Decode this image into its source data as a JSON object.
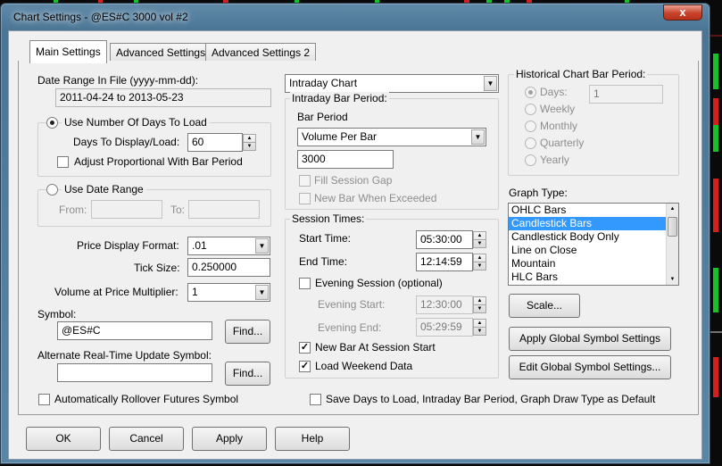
{
  "window": {
    "title": "Chart Settings - @ES#C  3000 vol  #2",
    "close_glyph": "x"
  },
  "tabs": [
    {
      "label": "Main Settings",
      "active": true
    },
    {
      "label": "Advanced Settings",
      "active": false
    },
    {
      "label": "Advanced Settings 2",
      "active": false
    }
  ],
  "date_range": {
    "label": "Date Range In File (yyyy-mm-dd):",
    "value": "2011-04-24 to 2013-05-23"
  },
  "days_to_load": {
    "radio_label": "Use Number Of Days To Load",
    "selected": true,
    "days_label": "Days To Display/Load:",
    "days_value": "60",
    "adjust_label": "Adjust Proportional With Bar Period",
    "adjust_checked": false
  },
  "date_range_group": {
    "radio_label": "Use Date Range",
    "selected": false,
    "from_label": "From:",
    "to_label": "To:",
    "from_value": "",
    "to_value": ""
  },
  "price_display_format": {
    "label": "Price Display Format:",
    "value": ".01"
  },
  "tick_size": {
    "label": "Tick Size:",
    "value": "0.250000"
  },
  "volume_multiplier": {
    "label": "Volume at Price Multiplier:",
    "value": "1"
  },
  "symbol": {
    "label": "Symbol:",
    "value": "@ES#C",
    "find_label": "Find..."
  },
  "alt_symbol": {
    "label": "Alternate Real-Time Update Symbol:",
    "value": "",
    "find_label": "Find..."
  },
  "auto_rollover": {
    "label": "Automatically Rollover Futures Symbol",
    "checked": false
  },
  "chart_type": {
    "value": "Intraday Chart"
  },
  "intraday_bar_period": {
    "group_title": "Intraday Bar Period:",
    "bar_period_label": "Bar Period",
    "bar_period_value": "Volume Per Bar",
    "bar_amount": "3000",
    "fill_session_gap_label": "Fill Session Gap",
    "new_bar_exceeded_label": "New Bar When Exceeded"
  },
  "session_times": {
    "group_title": "Session Times:",
    "start_label": "Start Time:",
    "start_value": "05:30:00",
    "end_label": "End Time:",
    "end_value": "12:14:59",
    "evening_label": "Evening Session (optional)",
    "evening_checked": false,
    "evening_start_label": "Evening Start:",
    "evening_start_value": "12:30:00",
    "evening_end_label": "Evening End:",
    "evening_end_value": "05:29:59",
    "new_bar_label": "New Bar At Session Start",
    "new_bar_checked": true,
    "weekend_label": "Load Weekend Data",
    "weekend_checked": true
  },
  "historical": {
    "group_title": "Historical Chart Bar Period:",
    "options": [
      "Days:",
      "Weekly",
      "Monthly",
      "Quarterly",
      "Yearly"
    ],
    "days_value": "1"
  },
  "graph_type": {
    "label": "Graph Type:",
    "items": [
      "OHLC Bars",
      "Candlestick Bars",
      "Candlestick Body Only",
      "Line on Close",
      "Mountain",
      "HLC Bars"
    ],
    "selected": "Candlestick Bars"
  },
  "side_buttons": {
    "scale": "Scale...",
    "apply_global": "Apply Global Symbol Settings",
    "edit_global": "Edit Global Symbol Settings..."
  },
  "save_default": {
    "label": "Save Days to Load, Intraday Bar Period, Graph Draw Type as Default",
    "checked": false
  },
  "footer": {
    "ok": "OK",
    "cancel": "Cancel",
    "apply": "Apply",
    "help": "Help"
  },
  "colors": {
    "selection": "#3399ff",
    "title_glow": "#ffffff",
    "close": "#c7432b"
  }
}
